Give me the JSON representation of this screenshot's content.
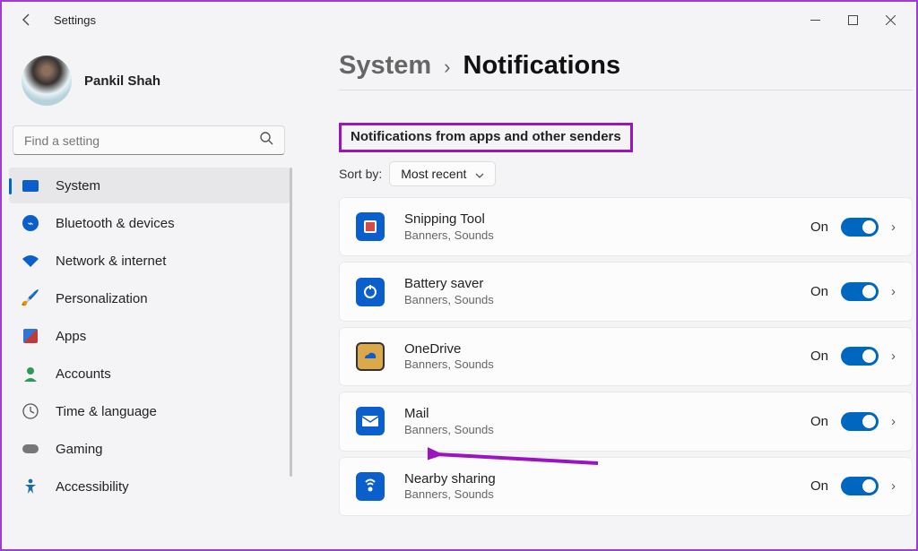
{
  "window": {
    "title": "Settings"
  },
  "user": {
    "name": "Pankil Shah"
  },
  "search": {
    "placeholder": "Find a setting"
  },
  "nav": {
    "items": [
      {
        "label": "System",
        "selected": true
      },
      {
        "label": "Bluetooth & devices"
      },
      {
        "label": "Network & internet"
      },
      {
        "label": "Personalization"
      },
      {
        "label": "Apps"
      },
      {
        "label": "Accounts"
      },
      {
        "label": "Time & language"
      },
      {
        "label": "Gaming"
      },
      {
        "label": "Accessibility"
      }
    ]
  },
  "breadcrumb": {
    "parent": "System",
    "separator": "›",
    "current": "Notifications"
  },
  "section": {
    "heading": "Notifications from apps and other senders"
  },
  "sort": {
    "label": "Sort by:",
    "value": "Most recent"
  },
  "apps": [
    {
      "name": "Snipping Tool",
      "sub": "Banners, Sounds",
      "state": "On",
      "icon": "snip"
    },
    {
      "name": "Battery saver",
      "sub": "Banners, Sounds",
      "state": "On",
      "icon": "batt"
    },
    {
      "name": "OneDrive",
      "sub": "Banners, Sounds",
      "state": "On",
      "icon": "onedrive"
    },
    {
      "name": "Mail",
      "sub": "Banners, Sounds",
      "state": "On",
      "icon": "mail"
    },
    {
      "name": "Nearby sharing",
      "sub": "Banners, Sounds",
      "state": "On",
      "icon": "share"
    }
  ]
}
